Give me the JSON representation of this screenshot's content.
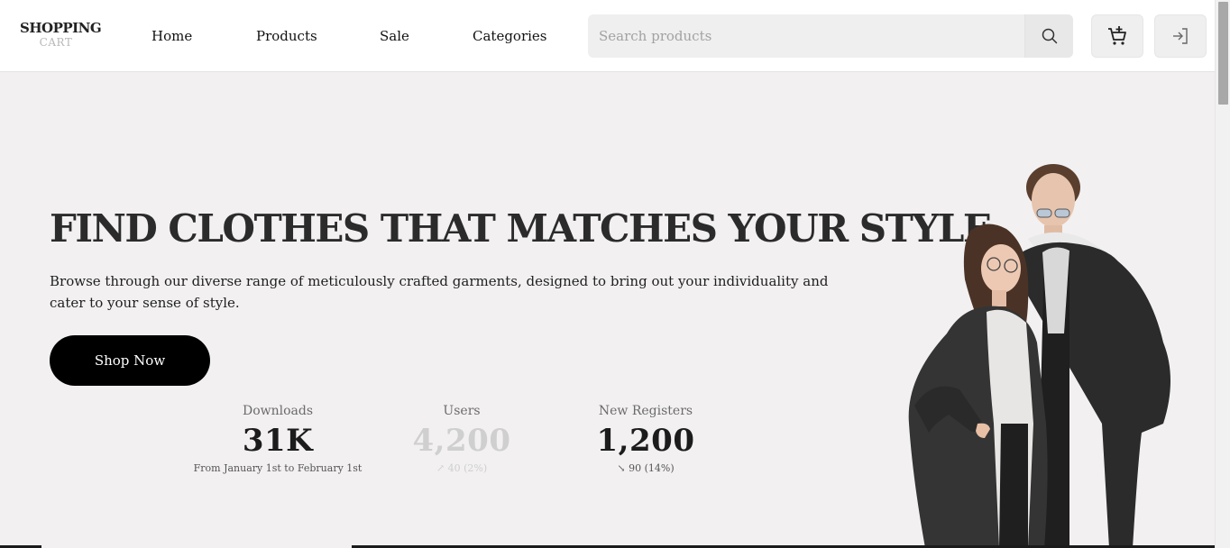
{
  "logo": {
    "top": "SHOPPING",
    "bottom": "CART"
  },
  "nav": [
    {
      "label": "Home"
    },
    {
      "label": "Products"
    },
    {
      "label": "Sale"
    },
    {
      "label": "Categories"
    }
  ],
  "search": {
    "placeholder": "Search products",
    "value": "",
    "icon": "search-icon"
  },
  "header_icons": {
    "cart": "cart-add-icon",
    "login": "login-icon"
  },
  "hero": {
    "title": "FIND CLOTHES THAT MATCHES YOUR STYLE",
    "description": "Browse through our diverse range of meticulously crafted garments, designed to bring out your individuality and cater to your sense of style.",
    "cta": "Shop Now"
  },
  "stats": [
    {
      "label": "Downloads",
      "value": "31K",
      "desc": "From January 1st to February 1st"
    },
    {
      "label": "Users",
      "value": "4,200",
      "desc": "↗ 40 (2%)"
    },
    {
      "label": "New Registers",
      "value": "1,200",
      "desc": "↘ 90 (14%)"
    }
  ],
  "colors": {
    "background": "#f2f0f1",
    "header": "#ffffff",
    "button": "#000000",
    "text": "#2b2b2b"
  }
}
